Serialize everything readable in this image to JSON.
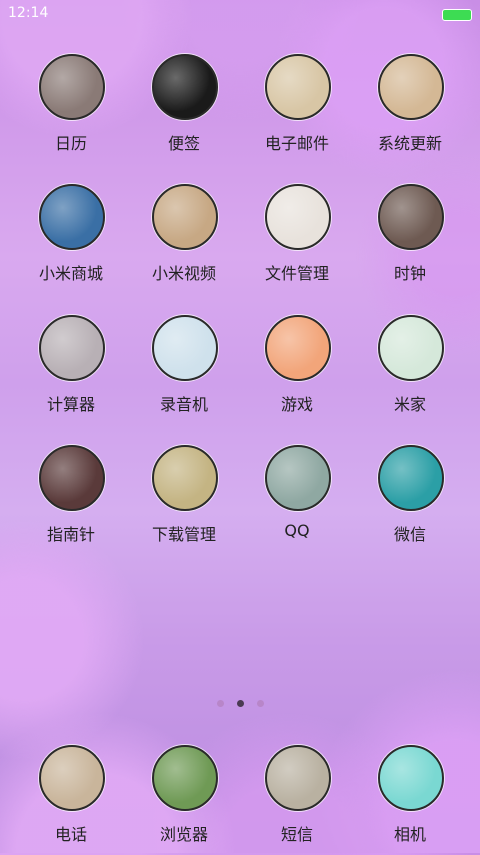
{
  "status": {
    "time": "12:14"
  },
  "apps": [
    {
      "label": "日历",
      "icon": "calendar-icon",
      "bg": "#8a7a76"
    },
    {
      "label": "便签",
      "icon": "notes-icon",
      "bg": "#1a1a1a"
    },
    {
      "label": "电子邮件",
      "icon": "email-icon",
      "bg": "#d8c6a5"
    },
    {
      "label": "系统更新",
      "icon": "update-icon",
      "bg": "#d4b895"
    },
    {
      "label": "小米商城",
      "icon": "mall-icon",
      "bg": "#3a6fa5"
    },
    {
      "label": "小米视频",
      "icon": "video-icon",
      "bg": "#c7a884"
    },
    {
      "label": "文件管理",
      "icon": "files-icon",
      "bg": "#e8e2dc"
    },
    {
      "label": "时钟",
      "icon": "clock-icon",
      "bg": "#6e5a52"
    },
    {
      "label": "计算器",
      "icon": "calculator-icon",
      "bg": "#b8b0b5"
    },
    {
      "label": "录音机",
      "icon": "recorder-icon",
      "bg": "#cfe1ec"
    },
    {
      "label": "游戏",
      "icon": "game-icon",
      "bg": "#f2a57a"
    },
    {
      "label": "米家",
      "icon": "mijia-icon",
      "bg": "#d5e8da"
    },
    {
      "label": "指南针",
      "icon": "compass-icon",
      "bg": "#5a3a3a"
    },
    {
      "label": "下载管理",
      "icon": "download-icon",
      "bg": "#c4b483"
    },
    {
      "label": "QQ",
      "icon": "qq-icon",
      "bg": "#8fa8a2"
    },
    {
      "label": "微信",
      "icon": "wechat-icon",
      "bg": "#2b9fa6"
    }
  ],
  "dock": [
    {
      "label": "电话",
      "icon": "phone-icon",
      "bg": "#c9b59b"
    },
    {
      "label": "浏览器",
      "icon": "browser-icon",
      "bg": "#6f9a55"
    },
    {
      "label": "短信",
      "icon": "sms-icon",
      "bg": "#b9b1a1"
    },
    {
      "label": "相机",
      "icon": "camera-icon",
      "bg": "#7ad8d2"
    }
  ],
  "page_indicator": {
    "count": 3,
    "active": 2
  }
}
